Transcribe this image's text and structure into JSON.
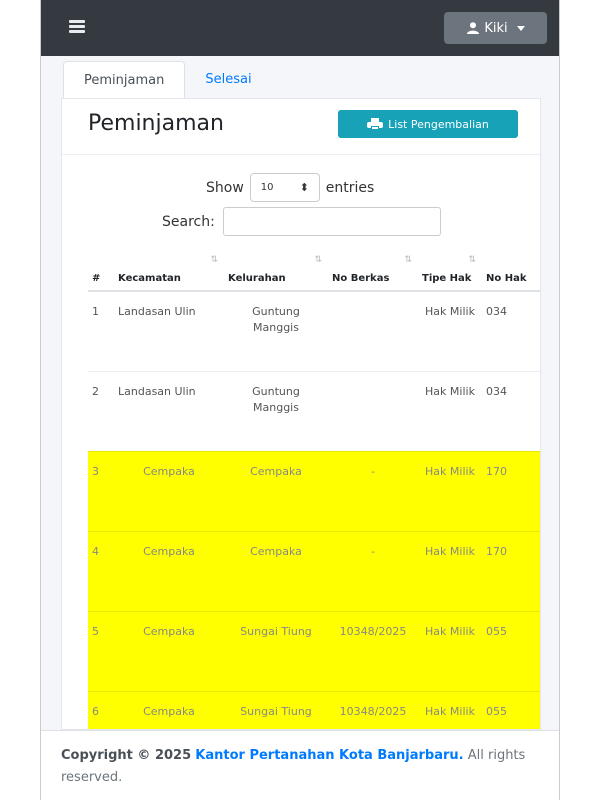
{
  "user": {
    "name": "Kiki"
  },
  "tabs": [
    {
      "label": "Peminjaman"
    },
    {
      "label": "Selesai"
    }
  ],
  "card": {
    "title": "Peminjaman",
    "list_button": "List Pengembalian"
  },
  "datatable": {
    "show_label": "Show",
    "length_value": "10",
    "entries_label": "entries",
    "search_label": "Search:",
    "search_value": ""
  },
  "table": {
    "headers": [
      "#",
      "Kecamatan",
      "Kelurahan",
      "No Berkas",
      "Tipe Hak",
      "No Hak"
    ],
    "rows": [
      {
        "num": "1",
        "kecamatan": "Landasan Ulin",
        "kelurahan": "Guntung Manggis",
        "berkas": "",
        "tipe": "Hak Milik",
        "nohak": "034",
        "highlight": false
      },
      {
        "num": "2",
        "kecamatan": "Landasan Ulin",
        "kelurahan": "Guntung Manggis",
        "berkas": "",
        "tipe": "Hak Milik",
        "nohak": "034",
        "highlight": false
      },
      {
        "num": "3",
        "kecamatan": "Cempaka",
        "kelurahan": "Cempaka",
        "berkas": "-",
        "tipe": "Hak Milik",
        "nohak": "170",
        "highlight": true
      },
      {
        "num": "4",
        "kecamatan": "Cempaka",
        "kelurahan": "Cempaka",
        "berkas": "-",
        "tipe": "Hak Milik",
        "nohak": "170",
        "highlight": true
      },
      {
        "num": "5",
        "kecamatan": "Cempaka",
        "kelurahan": "Sungai Tiung",
        "berkas": "10348/2025",
        "tipe": "Hak Milik",
        "nohak": "055",
        "highlight": true
      },
      {
        "num": "6",
        "kecamatan": "Cempaka",
        "kelurahan": "Sungai Tiung",
        "berkas": "10348/2025",
        "tipe": "Hak Milik",
        "nohak": "055",
        "highlight": true
      }
    ]
  },
  "footer": {
    "copyright": "Copyright © 2025",
    "org": "Kantor Pertanahan Kota Banjarbaru.",
    "rights": "All rights reserved."
  },
  "colors": {
    "navbar": "#343a40",
    "accent": "#17a2b8",
    "highlight_row": "#ffff00",
    "link": "#007bff"
  }
}
